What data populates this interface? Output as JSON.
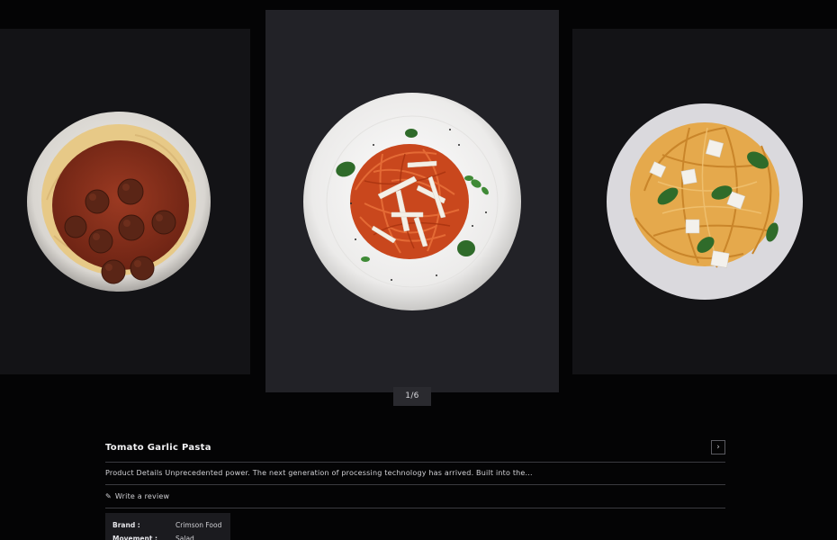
{
  "gallery": {
    "counter": "1/6",
    "slides": [
      {
        "name": "spaghetti-meatballs-image"
      },
      {
        "name": "tomato-garlic-pasta-image"
      },
      {
        "name": "spaghetti-basil-feta-image"
      }
    ]
  },
  "product": {
    "title": "Tomato Garlic Pasta",
    "description": "Product Details Unprecedented power. The next generation of processing technology has arrived. Built into the...",
    "review_link": "Write a review",
    "next_icon": "chevron-right-icon",
    "review_icon": "pencil-icon",
    "specs": [
      {
        "label": "Brand :",
        "value": "Crimson Food"
      },
      {
        "label": "Movement :",
        "value": "Salad"
      }
    ]
  },
  "colors": {
    "background": "#040405",
    "slide_side": "#131316",
    "slide_center": "#222227",
    "divider": "#3a3a3f"
  }
}
